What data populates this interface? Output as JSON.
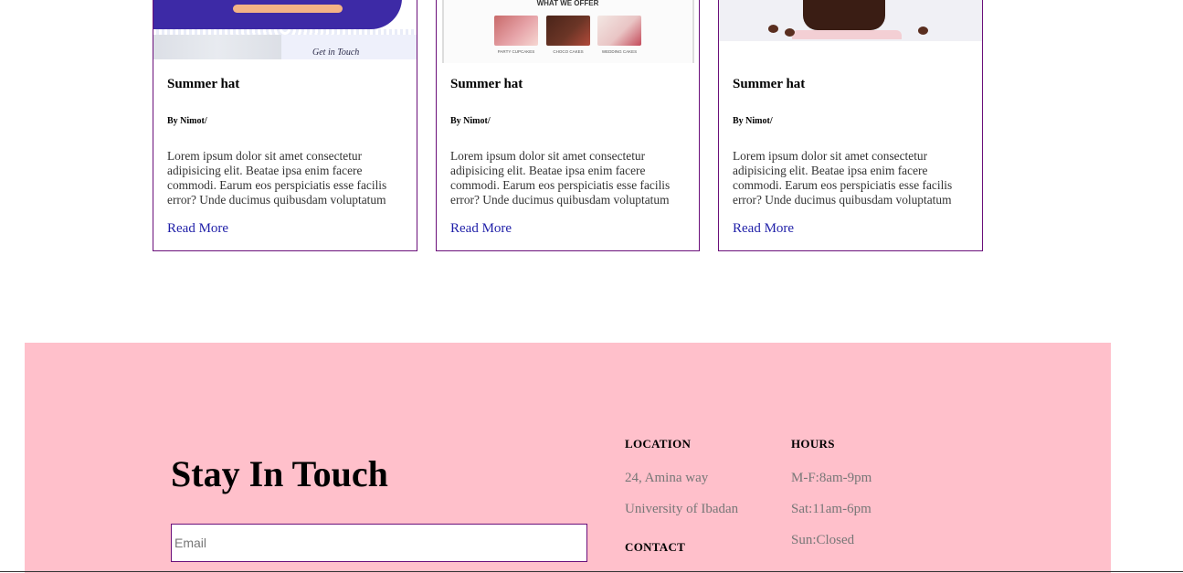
{
  "cards": [
    {
      "title": "Summer hat",
      "author": "By Nimot/",
      "excerpt": "Lorem ipsum dolor sit amet consectetur adipisicing elit. Beatae ipsa enim facere commodi. Earum eos perspiciatis esse facilis error? Unde ducimus quibusdam voluptatum",
      "read_more": "Read More",
      "thumb": {
        "caption": "Get in Touch"
      }
    },
    {
      "title": "Summer hat",
      "author": "By Nimot/",
      "excerpt": "Lorem ipsum dolor sit amet consectetur adipisicing elit. Beatae ipsa enim facere commodi. Earum eos perspiciatis esse facilis error? Unde ducimus quibusdam voluptatum",
      "read_more": "Read More",
      "thumb": {
        "heading": "WHAT WE OFFER",
        "items": [
          "PARTY CUPCAKES",
          "CHOCO CAKES",
          "WEDDING CAKES"
        ]
      }
    },
    {
      "title": "Summer hat",
      "author": "By Nimot/",
      "excerpt": "Lorem ipsum dolor sit amet consectetur adipisicing elit. Beatae ipsa enim facere commodi. Earum eos perspiciatis esse facilis error? Unde ducimus quibusdam voluptatum",
      "read_more": "Read More"
    }
  ],
  "footer": {
    "heading": "Stay In Touch",
    "email_placeholder": "Email",
    "location": {
      "label": "LOCATION",
      "line1": "24, Amina way",
      "line2": "University of Ibadan"
    },
    "contact": {
      "label": "CONTACT"
    },
    "hours": {
      "label": "HOURS",
      "weekdays": "M-F:8am-9pm",
      "saturday": "Sat:11am-6pm",
      "sunday": "Sun:Closed"
    }
  },
  "colors": {
    "card_border": "#6a0f7a",
    "link": "#1f1fa8",
    "footer_bg": "#ffc0cb"
  }
}
